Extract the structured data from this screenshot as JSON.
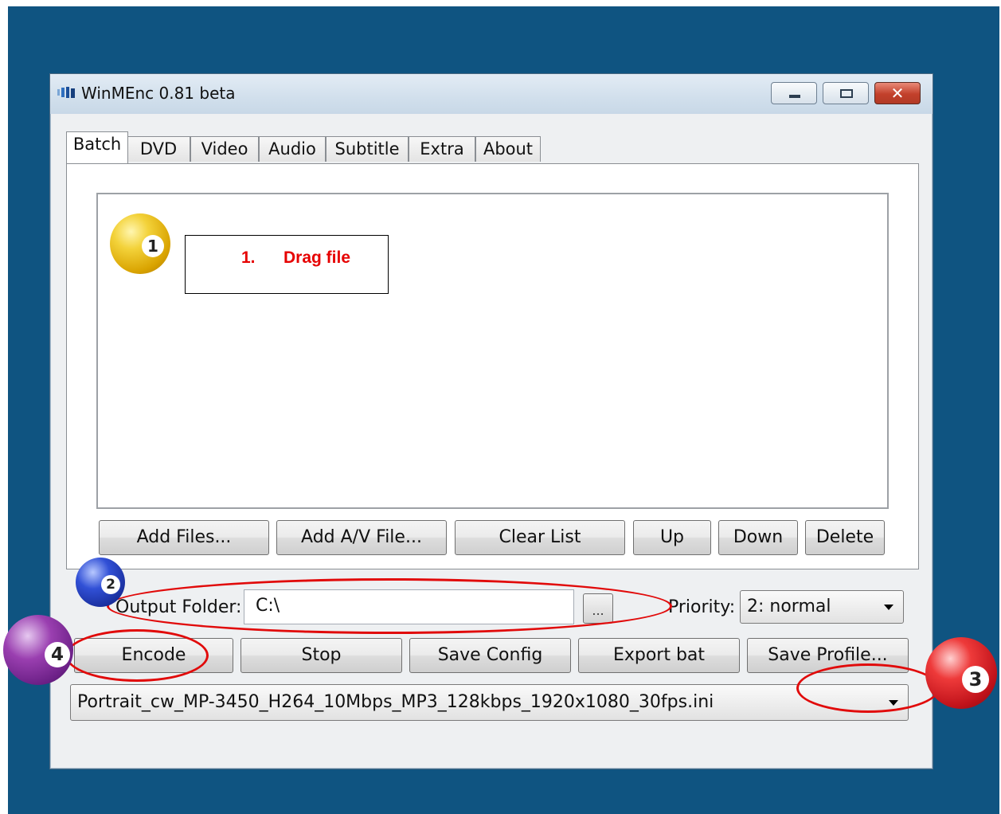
{
  "window": {
    "title": "WinMEnc 0.81 beta",
    "close_glyph": "✕"
  },
  "tabs": [
    {
      "label": "Batch",
      "active": true
    },
    {
      "label": "DVD"
    },
    {
      "label": "Video"
    },
    {
      "label": "Audio"
    },
    {
      "label": "Subtitle"
    },
    {
      "label": "Extra"
    },
    {
      "label": "About"
    }
  ],
  "annotation": {
    "step_number": "1.",
    "step_text": "Drag file"
  },
  "list_buttons": {
    "add_files": "Add Files...",
    "add_av_file": "Add A/V File...",
    "clear_list": "Clear List",
    "up": "Up",
    "down": "Down",
    "delete": "Delete"
  },
  "output": {
    "label": "Output Folder:",
    "value": "C:\\",
    "browse": "..."
  },
  "priority": {
    "label": "Priority:",
    "selected": "2: normal"
  },
  "actions": {
    "encode": "Encode",
    "stop": "Stop",
    "save_config": "Save Config",
    "export_bat": "Export bat",
    "save_profile": "Save Profile..."
  },
  "profile": {
    "selected": "Portrait_cw_MP-3450_H264_10Mbps_MP3_128kbps_1920x1080_30fps.ini"
  },
  "markers": {
    "one": "1",
    "two": "2",
    "three": "3",
    "four": "4"
  },
  "colors": {
    "desktop": "#0f5481",
    "annotation_red": "#e60000",
    "ring_red": "#e10a0a"
  }
}
